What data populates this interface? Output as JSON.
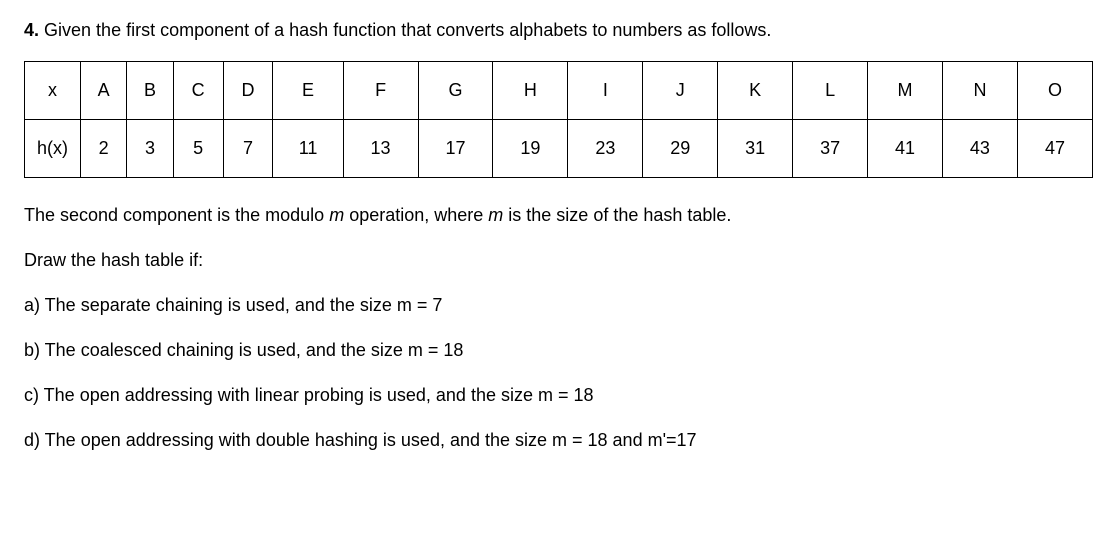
{
  "question": {
    "number": "4.",
    "text": "Given the first component of a hash function that converts alphabets to numbers as follows."
  },
  "table": {
    "row1": {
      "header": "x",
      "cells": [
        "A",
        "B",
        "C",
        "D",
        "E",
        "F",
        "G",
        "H",
        "I",
        "J",
        "K",
        "L",
        "M",
        "N",
        "O"
      ]
    },
    "row2": {
      "header": "h(x)",
      "cells": [
        "2",
        "3",
        "5",
        "7",
        "11",
        "13",
        "17",
        "19",
        "23",
        "29",
        "31",
        "37",
        "41",
        "43",
        "47"
      ]
    }
  },
  "description": {
    "line1_a": "The second component is the modulo ",
    "line1_m1": "m",
    "line1_b": " operation, where ",
    "line1_m2": "m",
    "line1_c": " is the size of the hash table.",
    "line2": "Draw the hash table if:",
    "a": "a) The separate chaining is used, and the size m = 7",
    "b": "b) The coalesced chaining is used, and the size m = 18",
    "c": "c) The open addressing with linear probing is used, and the size m = 18",
    "d": "d) The open addressing with double hashing is used, and the size m = 18 and m'=17"
  }
}
